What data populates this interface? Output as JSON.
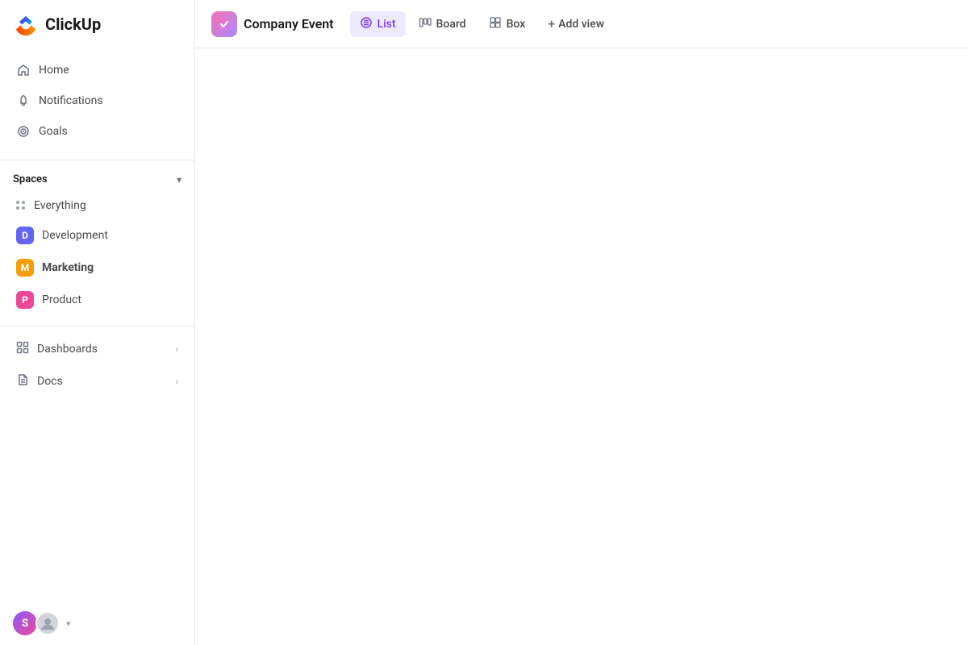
{
  "app": {
    "name": "ClickUp"
  },
  "sidebar": {
    "nav_items": [
      {
        "id": "home",
        "label": "Home",
        "icon": "home-icon"
      },
      {
        "id": "notifications",
        "label": "Notifications",
        "icon": "bell-icon"
      },
      {
        "id": "goals",
        "label": "Goals",
        "icon": "target-icon"
      }
    ],
    "spaces_label": "Spaces",
    "spaces": [
      {
        "id": "everything",
        "label": "Everything",
        "type": "everything"
      },
      {
        "id": "development",
        "label": "Development",
        "type": "avatar",
        "letter": "D",
        "class": "dev"
      },
      {
        "id": "marketing",
        "label": "Marketing",
        "type": "avatar",
        "letter": "M",
        "class": "marketing",
        "active": true
      },
      {
        "id": "product",
        "label": "Product",
        "type": "avatar",
        "letter": "P",
        "class": "product"
      }
    ],
    "sections": [
      {
        "id": "dashboards",
        "label": "Dashboards"
      },
      {
        "id": "docs",
        "label": "Docs"
      }
    ],
    "footer": {
      "avatar_letter": "S"
    }
  },
  "topbar": {
    "workspace_title": "Company Event",
    "views": [
      {
        "id": "list",
        "label": "List",
        "icon": "list-icon",
        "active": true
      },
      {
        "id": "board",
        "label": "Board",
        "icon": "board-icon",
        "active": false
      },
      {
        "id": "box",
        "label": "Box",
        "icon": "box-icon",
        "active": false
      }
    ],
    "add_view_label": "Add view"
  }
}
